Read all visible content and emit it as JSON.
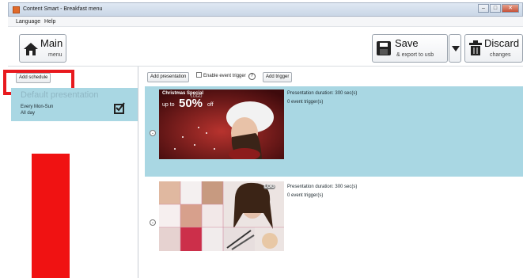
{
  "window": {
    "title": "Content Smart - Breakfast menu",
    "minimize": "–",
    "maximize": "□",
    "close": "✕"
  },
  "menu": {
    "language": "Language",
    "help": "Help"
  },
  "toolbar": {
    "main_label": "Main",
    "main_sub": "menu",
    "save_label": "Save",
    "save_sub": "& export to usb",
    "discard_label": "Discard",
    "discard_sub": "changes"
  },
  "left": {
    "add_schedule": "Add schedule",
    "schedule": {
      "title": "Default presentation",
      "days": "Every Mon-Sun",
      "time": "All day"
    }
  },
  "right": {
    "add_presentation": "Add presentation",
    "enable_trigger": "Enable event trigger",
    "help": "?",
    "add_trigger": "Add trigger",
    "presentations": [
      {
        "duration": "Presentation duration: 300 sec(s)",
        "triggers": "0 event trigger(s)",
        "banner_line1": "Christmas Special",
        "banner_line2": "up to",
        "banner_percent": "50%",
        "banner_off": "off",
        "logo": "LOGO"
      },
      {
        "duration": "Presentation duration: 300 sec(s)",
        "triggers": "0 event trigger(s)",
        "logo": "LOG"
      }
    ]
  },
  "colors": {
    "accent": "#a9d7e3",
    "highlight": "#e8191e",
    "red_bar": "#f01212"
  }
}
